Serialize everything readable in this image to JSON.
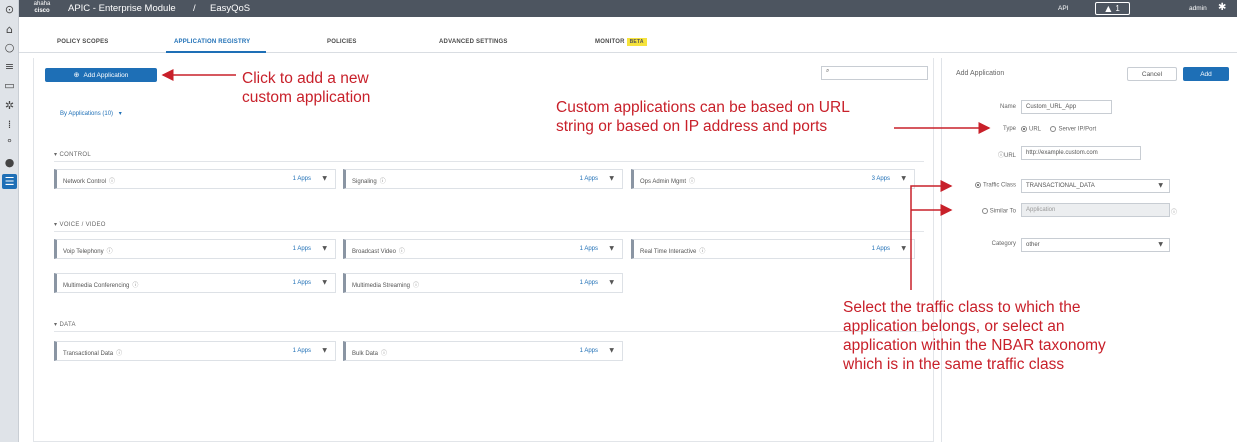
{
  "header": {
    "logo_line1": "ahaha",
    "logo_line2": "cisco",
    "app_title": "APIC - Enterprise Module",
    "separator": "/",
    "breadcrumb": "EasyQoS",
    "api_label": "API",
    "notification_count": "1",
    "user": "admin"
  },
  "tabs": [
    {
      "label": "POLICY SCOPES"
    },
    {
      "label": "APPLICATION REGISTRY"
    },
    {
      "label": "POLICIES"
    },
    {
      "label": "ADVANCED SETTINGS"
    },
    {
      "label": "MONITOR",
      "badge": "BETA"
    }
  ],
  "main": {
    "add_button": "Add Application",
    "search_placeholder": "",
    "filter_label": "By Applications (10)",
    "sections": [
      {
        "title": "CONTROL",
        "cards": [
          {
            "name": "Network Control",
            "apps": "1 Apps"
          },
          {
            "name": "Signaling",
            "apps": "1 Apps"
          },
          {
            "name": "Ops Admin Mgmt",
            "apps": "3 Apps"
          }
        ]
      },
      {
        "title": "VOICE / VIDEO",
        "cards": [
          {
            "name": "Voip Telephony",
            "apps": "1 Apps"
          },
          {
            "name": "Broadcast Video",
            "apps": "1 Apps"
          },
          {
            "name": "Real Time Interactive",
            "apps": "1 Apps"
          },
          {
            "name": "Multimedia Conferencing",
            "apps": "1 Apps"
          },
          {
            "name": "Multimedia Streaming",
            "apps": "1 Apps"
          }
        ]
      },
      {
        "title": "DATA",
        "cards": [
          {
            "name": "Transactional Data",
            "apps": "1 Apps"
          },
          {
            "name": "Bulk Data",
            "apps": "1 Apps"
          }
        ]
      }
    ]
  },
  "panel": {
    "title": "Add Application",
    "cancel": "Cancel",
    "add": "Add",
    "name_label": "Name",
    "name_value": "Custom_URL_App",
    "type_label": "Type",
    "type_url": "URL",
    "type_server": "Server IP/Port",
    "url_label": "URL",
    "url_value": "http://example.custom.com",
    "traffic_class_label": "Traffic Class",
    "traffic_class_value": "TRANSACTIONAL_DATA",
    "similar_to_label": "Similar To",
    "similar_to_placeholder": "Application",
    "category_label": "Category",
    "category_value": "other"
  },
  "annotations": {
    "add_note_1": "Click to add a new",
    "add_note_2": "custom application",
    "type_note_1": "Custom applications can be based on URL",
    "type_note_2": "string or based on IP address and ports",
    "class_note_1": "Select the traffic class to which the",
    "class_note_2": "application belongs, or select an",
    "class_note_3": "application within the NBAR taxonomy",
    "class_note_4": "which is in the same traffic class"
  },
  "colors": {
    "accent": "#1e6fb6",
    "header_bg": "#4d5560",
    "annotation": "#c8202a"
  }
}
